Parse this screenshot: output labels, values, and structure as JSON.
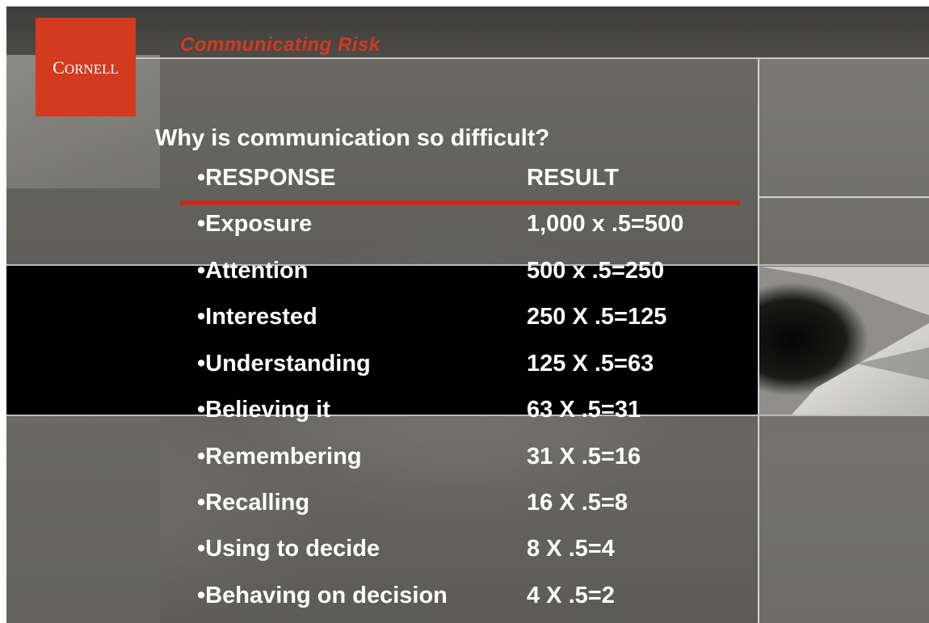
{
  "header": {
    "logo_text_big": "C",
    "logo_text_small": "ORNELL",
    "title": "Communicating Risk"
  },
  "slide": {
    "question": "Why is communication so difficult?",
    "table": {
      "headers": {
        "response": "•RESPONSE",
        "result": "RESULT"
      },
      "rows": [
        {
          "response": "•Exposure",
          "result": "1,000 x .5=500"
        },
        {
          "response": "•Attention",
          "result": "500 x .5=250"
        },
        {
          "response": "•Interested",
          "result": "250 X .5=125"
        },
        {
          "response": "•Understanding",
          "result": "125 X .5=63"
        },
        {
          "response": "•Believing it",
          "result": "63 X .5=31"
        },
        {
          "response": "•Remembering",
          "result": "31 X .5=16"
        },
        {
          "response": "•Recalling",
          "result": "16 X .5=8"
        },
        {
          "response": "•Using to decide",
          "result": "8 X .5=4"
        },
        {
          "response": "•Behaving on decision",
          "result": "4 X .5=2"
        }
      ]
    }
  },
  "colors": {
    "brand_red": "#d43a1f",
    "underline_red": "#c42a1a",
    "text": "#ffffff",
    "band": "#000000"
  }
}
